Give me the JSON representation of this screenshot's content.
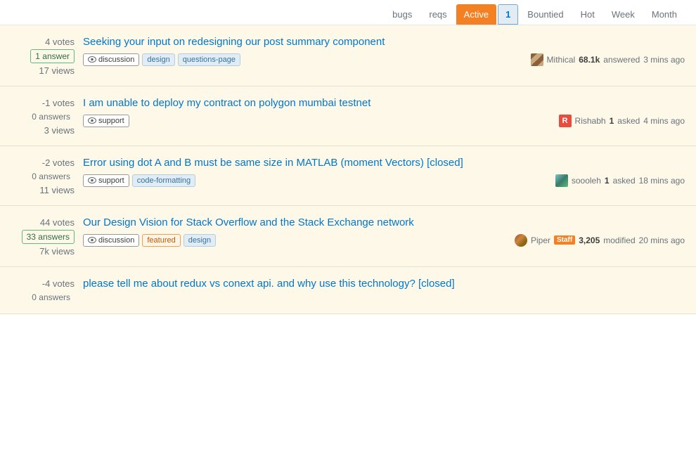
{
  "tabs": [
    {
      "label": "bugs",
      "id": "bugs",
      "active": false,
      "notification": false
    },
    {
      "label": "reqs",
      "id": "reqs",
      "active": false,
      "notification": false
    },
    {
      "label": "Active",
      "id": "active",
      "active": true,
      "notification": false
    },
    {
      "label": "1",
      "id": "notification",
      "active": false,
      "notification": true
    },
    {
      "label": "Bountied",
      "id": "bountied",
      "active": false,
      "notification": false
    },
    {
      "label": "Hot",
      "id": "hot",
      "active": false,
      "notification": false
    },
    {
      "label": "Week",
      "id": "week",
      "active": false,
      "notification": false
    },
    {
      "label": "Month",
      "id": "month",
      "active": false,
      "notification": false
    }
  ],
  "questions": [
    {
      "id": "q1",
      "votes": "4 votes",
      "answers": "1 answer",
      "answers_class": "has-answer",
      "views": "17 views",
      "title": "Seeking your input on redesigning our post summary component",
      "tags": [
        {
          "label": "discussion",
          "type": "moderated"
        },
        {
          "label": "design",
          "type": "plain"
        },
        {
          "label": "questions-page",
          "type": "plain"
        }
      ],
      "user_name": "Mithical",
      "user_rep": "68.1k",
      "user_avatar": "pixel",
      "action": "answered",
      "time": "3 mins ago"
    },
    {
      "id": "q2",
      "votes": "-1 votes",
      "answers": "0 answers",
      "answers_class": "no-answer",
      "views": "3 views",
      "title": "I am unable to deploy my contract on polygon mumbai testnet",
      "tags": [
        {
          "label": "support",
          "type": "moderated"
        }
      ],
      "user_name": "Rishabh",
      "user_rep": "1",
      "user_avatar": "red-r",
      "action": "asked",
      "time": "4 mins ago"
    },
    {
      "id": "q3",
      "votes": "-2 votes",
      "answers": "0 answers",
      "answers_class": "no-answer",
      "views": "11 views",
      "title": "Error using dot A and B must be same size in MATLAB (moment Vectors) [closed]",
      "tags": [
        {
          "label": "support",
          "type": "moderated"
        },
        {
          "label": "code-formatting",
          "type": "plain"
        }
      ],
      "user_name": "soooleh",
      "user_rep": "1",
      "user_avatar": "green-sq",
      "action": "asked",
      "time": "18 mins ago"
    },
    {
      "id": "q4",
      "votes": "44 votes",
      "answers": "33 answers",
      "answers_class": "has-answer",
      "views": "7k views",
      "title": "Our Design Vision for Stack Overflow and the Stack Exchange network",
      "tags": [
        {
          "label": "discussion",
          "type": "moderated"
        },
        {
          "label": "featured",
          "type": "featured"
        },
        {
          "label": "design",
          "type": "plain"
        }
      ],
      "user_name": "Piper",
      "user_rep": "3,205",
      "user_avatar": "piper",
      "action": "modified",
      "time": "20 mins ago",
      "staff": true
    },
    {
      "id": "q5",
      "votes": "-4 votes",
      "answers": "0 answers",
      "answers_class": "no-answer",
      "views": "",
      "title": "please tell me about redux vs conext api. and why use this technology? [closed]",
      "tags": [],
      "user_name": "",
      "user_rep": "",
      "user_avatar": "",
      "action": "",
      "time": ""
    }
  ],
  "colors": {
    "accent": "#f48024",
    "link": "#0077cc",
    "bg_yellow": "#fdf8e8"
  }
}
